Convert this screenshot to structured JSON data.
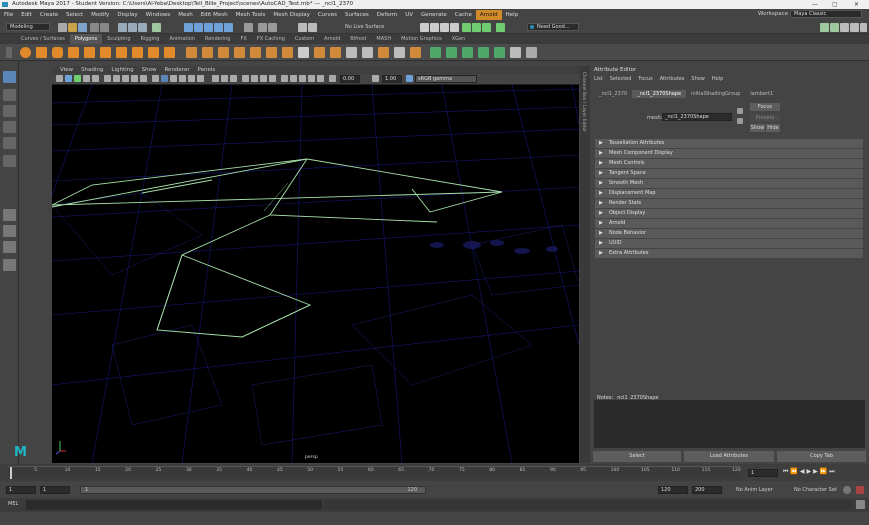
{
  "window": {
    "title": "Autodesk Maya 2017 - Student Version: C:\\Users\\Al-Yeba\\Desktop\\Tell_Bille_Project\\scenes\\AutoCAD_Test.mb* --- _ncl1_2370",
    "controls": [
      "—",
      "▢",
      "✕"
    ]
  },
  "menubar": {
    "items": [
      "File",
      "Edit",
      "Create",
      "Select",
      "Modify",
      "Display",
      "Windows",
      "Mesh",
      "Edit Mesh",
      "Mesh Tools",
      "Mesh Display",
      "Curves",
      "Surfaces",
      "Deform",
      "UV",
      "Generate",
      "Cache",
      "Arnold",
      "Help"
    ],
    "highlighted": "Arnold",
    "workspace_label": "Workspace :",
    "workspace_value": "Maya Classic"
  },
  "statusline": {
    "mode": "Modeling",
    "live_surface": "No Live Surface",
    "user": "Need Good..."
  },
  "shelf": {
    "tabs": [
      "Curves / Surfaces",
      "Polygons",
      "Sculpting",
      "Rigging",
      "Animation",
      "Rendering",
      "FX",
      "FX Caching",
      "Custom",
      "Arnold",
      "Bifrost",
      "MASH",
      "Motion Graphics",
      "XGen"
    ],
    "active_tab": "Polygons"
  },
  "panel": {
    "menu": [
      "View",
      "Shading",
      "Lighting",
      "Show",
      "Renderer",
      "Panels"
    ],
    "exposure": "0.00",
    "gamma": "1.00",
    "colorspace": "sRGB gamma",
    "camera_label": "persp"
  },
  "attribute_editor": {
    "title": "Attribute Editor",
    "menu": [
      "List",
      "Selected",
      "Focus",
      "Attributes",
      "Show",
      "Help"
    ],
    "tabs": [
      "_ncl1_2370",
      "_ncl1_2370Shape",
      "initialShadingGroup",
      "lambert1"
    ],
    "active_tab": "_ncl1_2370Shape",
    "mesh_label": "mesh:",
    "mesh_value": "_ncl1_2370Shape",
    "buttons": {
      "focus": "Focus",
      "presets": "Presets",
      "show": "Show",
      "hide": "Hide"
    },
    "sections": [
      "Tessellation Attributes",
      "Mesh Component Display",
      "Mesh Controls",
      "Tangent Space",
      "Smooth Mesh",
      "Displacement Map",
      "Render Stats",
      "Object Display",
      "Arnold",
      "Node Behavior",
      "UUID",
      "Extra Attributes"
    ],
    "notes_label": "Notes:",
    "notes_value": "_ncl1_2370Shape",
    "bottom_buttons": {
      "select": "Select",
      "load": "Load Attributes",
      "copy": "Copy Tab"
    },
    "side_strip_label": "Channel Box / Layer Editor"
  },
  "timeslider": {
    "ticks": [
      "5",
      "10",
      "15",
      "20",
      "25",
      "30",
      "35",
      "40",
      "45",
      "50",
      "55",
      "60",
      "65",
      "70",
      "75",
      "80",
      "85",
      "90",
      "95",
      "100",
      "105",
      "110",
      "115",
      "120"
    ],
    "current_frame": "1"
  },
  "rangeslider": {
    "start": "1",
    "playback_start": "1",
    "range_start_label": "1",
    "range_end_label": "120",
    "playback_end": "120",
    "end": "200",
    "anim_layer": "No Anim Layer",
    "character_set": "No Character Set"
  },
  "mel": {
    "label": "MEL"
  },
  "colors": {
    "accent": "#d08a2a",
    "shelf_icon_orange": "#e08a2c",
    "wire_green": "#9bd89b",
    "grid_blue": "#1a1a7a"
  }
}
